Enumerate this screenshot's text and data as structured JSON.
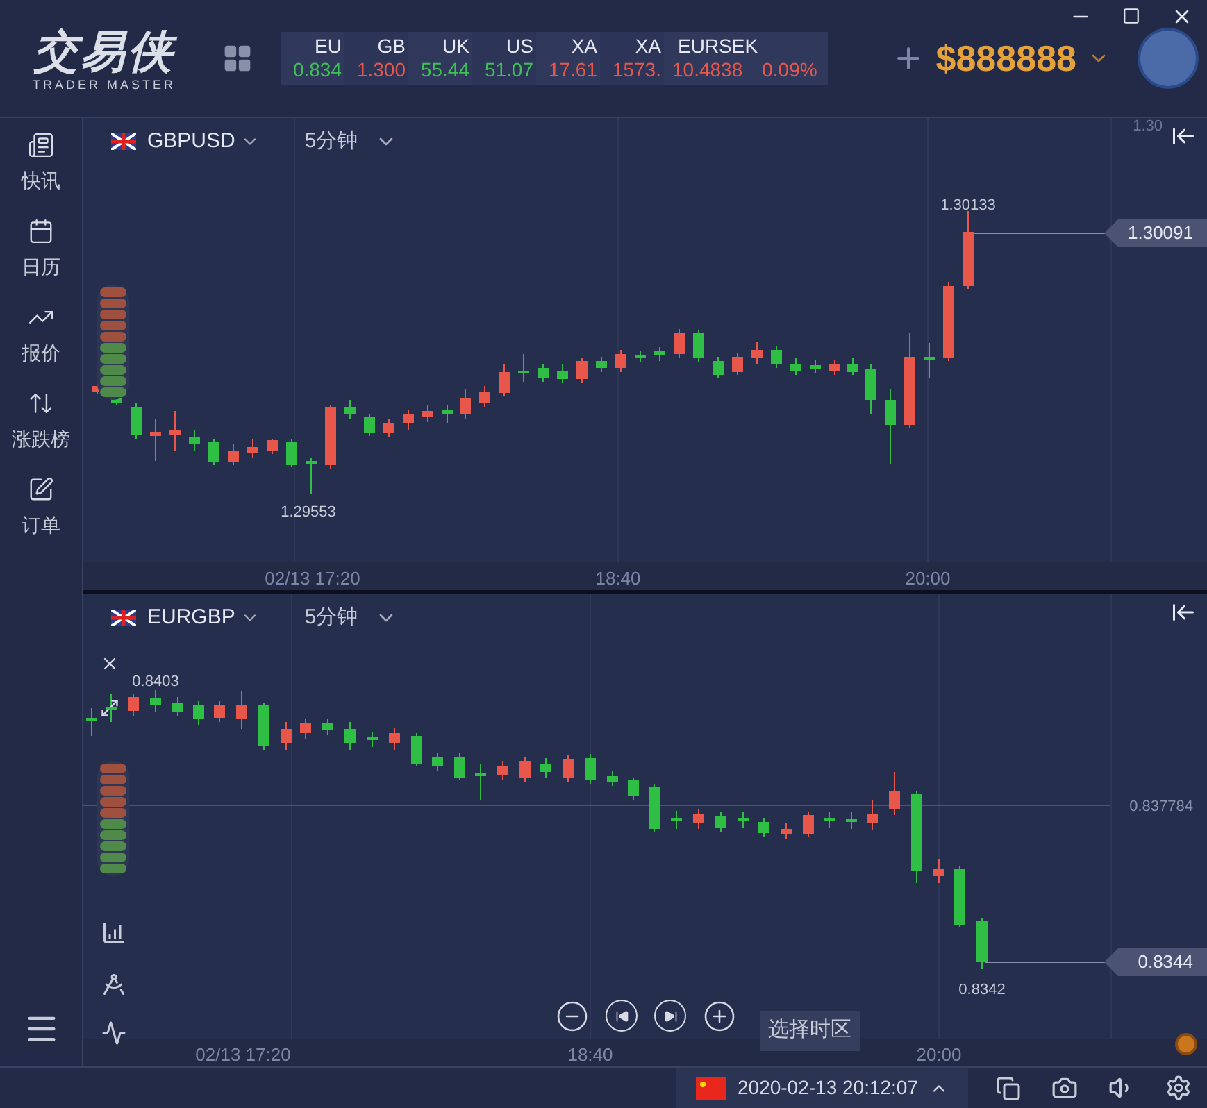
{
  "brand": {
    "name": "交易侠",
    "tagline": "TRADER MASTER"
  },
  "tickers": [
    {
      "symbol": "EU",
      "price": "0.834",
      "color": "#3fbf55"
    },
    {
      "symbol": "GB",
      "price": "1.300",
      "color": "#e8574a"
    },
    {
      "symbol": "UK",
      "price": "55.44",
      "color": "#3fbf55"
    },
    {
      "symbol": "US",
      "price": "51.07",
      "color": "#3fbf55"
    },
    {
      "symbol": "XA",
      "price": "17.61",
      "color": "#e8574a"
    },
    {
      "symbol": "XA",
      "price": "1573.",
      "color": "#e8574a"
    },
    {
      "symbol": "EURSEK",
      "price": "10.4838",
      "change": "0.09%",
      "color": "#e8574a"
    }
  ],
  "balance": {
    "amount": "$888888"
  },
  "sidebar": {
    "items": [
      {
        "label": "快讯",
        "kind": "news"
      },
      {
        "label": "日历",
        "kind": "calendar"
      },
      {
        "label": "报价",
        "kind": "quotes"
      },
      {
        "label": "涨跌榜",
        "kind": "movers"
      },
      {
        "label": "订单",
        "kind": "orders"
      }
    ]
  },
  "charts": [
    {
      "symbol": "GBPUSD",
      "interval": "5分钟",
      "edge_price": "1.30",
      "high_label": "1.30133",
      "low_label": "1.29553",
      "last_price": "1.30091",
      "time_labels": [
        "02/13 17:20",
        "18:40",
        "20:00"
      ],
      "show_tools": false
    },
    {
      "symbol": "EURGBP",
      "interval": "5分钟",
      "high_label": "0.8403",
      "low_label": "0.8342",
      "axis_price": "0.837784",
      "last_price": "0.8344",
      "time_labels": [
        "02/13 17:20",
        "18:40",
        "20:00"
      ],
      "show_tools": true
    }
  ],
  "status_bar": {
    "tooltip": "选择时区",
    "datetime": "2020-02-13 20:12:07"
  }
}
